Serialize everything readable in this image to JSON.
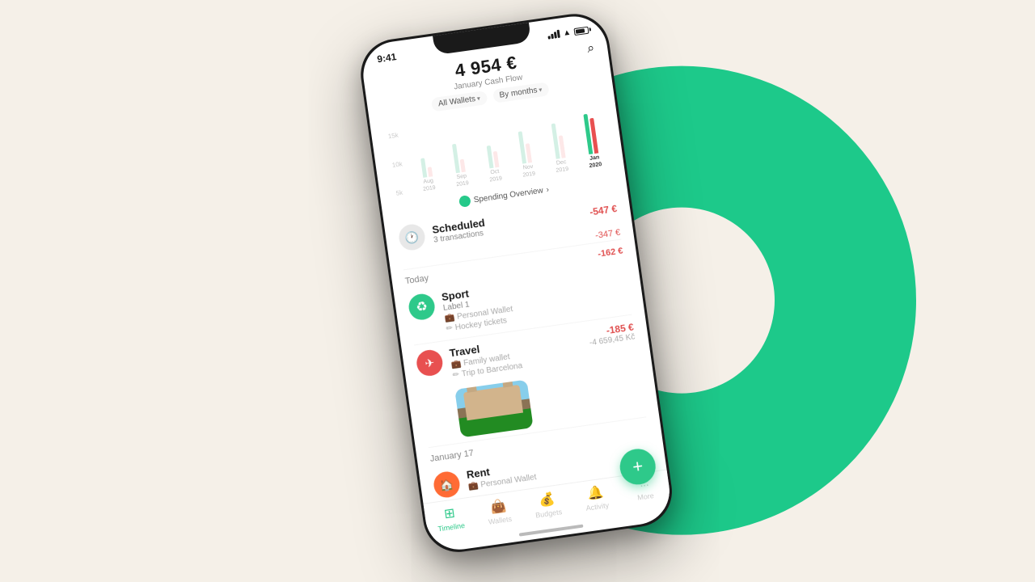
{
  "background": {
    "color": "#f5f0e8",
    "circle_color": "#1dc98a"
  },
  "phone": {
    "status_bar": {
      "time": "9:41",
      "signal": "●●●",
      "wifi": "WiFi",
      "battery": "80%"
    },
    "header": {
      "amount": "4 954 €",
      "subtitle": "January Cash Flow",
      "filter_wallets": "All Wallets",
      "filter_months": "By months",
      "search_icon": "search"
    },
    "chart": {
      "y_labels": [
        "15k",
        "10k",
        "5k"
      ],
      "columns": [
        {
          "label": "Aug\n2019",
          "green": 30,
          "red": 15,
          "active": false
        },
        {
          "label": "Sep\n2019",
          "green": 45,
          "red": 20,
          "active": false
        },
        {
          "label": "Oct\n2019",
          "green": 35,
          "red": 25,
          "active": false
        },
        {
          "label": "Nov\n2019",
          "green": 50,
          "red": 30,
          "active": false
        },
        {
          "label": "Dec\n2019",
          "green": 55,
          "red": 35,
          "active": false
        },
        {
          "label": "Jan\n2020",
          "green": 60,
          "red": 55,
          "active": true
        }
      ]
    },
    "spending_overview": {
      "label": "Spending Overview",
      "chevron": ">"
    },
    "sections": [
      {
        "type": "scheduled",
        "icon": "🕐",
        "icon_style": "gray",
        "title": "Scheduled",
        "subtitle": "3 transactions",
        "amount": "-547 €"
      }
    ],
    "today_section": {
      "label": "Today",
      "amount": "-162 €"
    },
    "transactions": [
      {
        "id": "sport",
        "icon": "♻",
        "icon_style": "green",
        "name": "Sport",
        "label": "Label 1",
        "wallet": "Personal Wallet",
        "note": "Hockey tickets",
        "amount": "",
        "amount_secondary": ""
      },
      {
        "id": "travel",
        "icon": "✈",
        "icon_style": "red",
        "name": "Travel",
        "label": "",
        "wallet": "Family wallet",
        "note": "Trip to Barcelona",
        "amount": "-185 €",
        "amount_secondary": "-4 659,45 Kč",
        "has_photo": true
      }
    ],
    "january17_section": {
      "label": "January 17",
      "amount": ""
    },
    "rent_transaction": {
      "id": "rent",
      "icon": "🏠",
      "icon_style": "orange",
      "name": "Rent",
      "wallet": "Personal Wallet"
    },
    "fab": {
      "label": "+",
      "aria": "Add transaction"
    },
    "bottom_nav": [
      {
        "id": "timeline",
        "icon": "⊡",
        "label": "Timeline",
        "active": true
      },
      {
        "id": "wallets",
        "icon": "👜",
        "label": "Wallets",
        "active": false
      },
      {
        "id": "budgets",
        "icon": "💰",
        "label": "Budgets",
        "active": false
      },
      {
        "id": "activity",
        "icon": "🔔",
        "label": "Activity",
        "active": false
      },
      {
        "id": "more",
        "icon": "•••",
        "label": "More",
        "active": false
      }
    ]
  }
}
